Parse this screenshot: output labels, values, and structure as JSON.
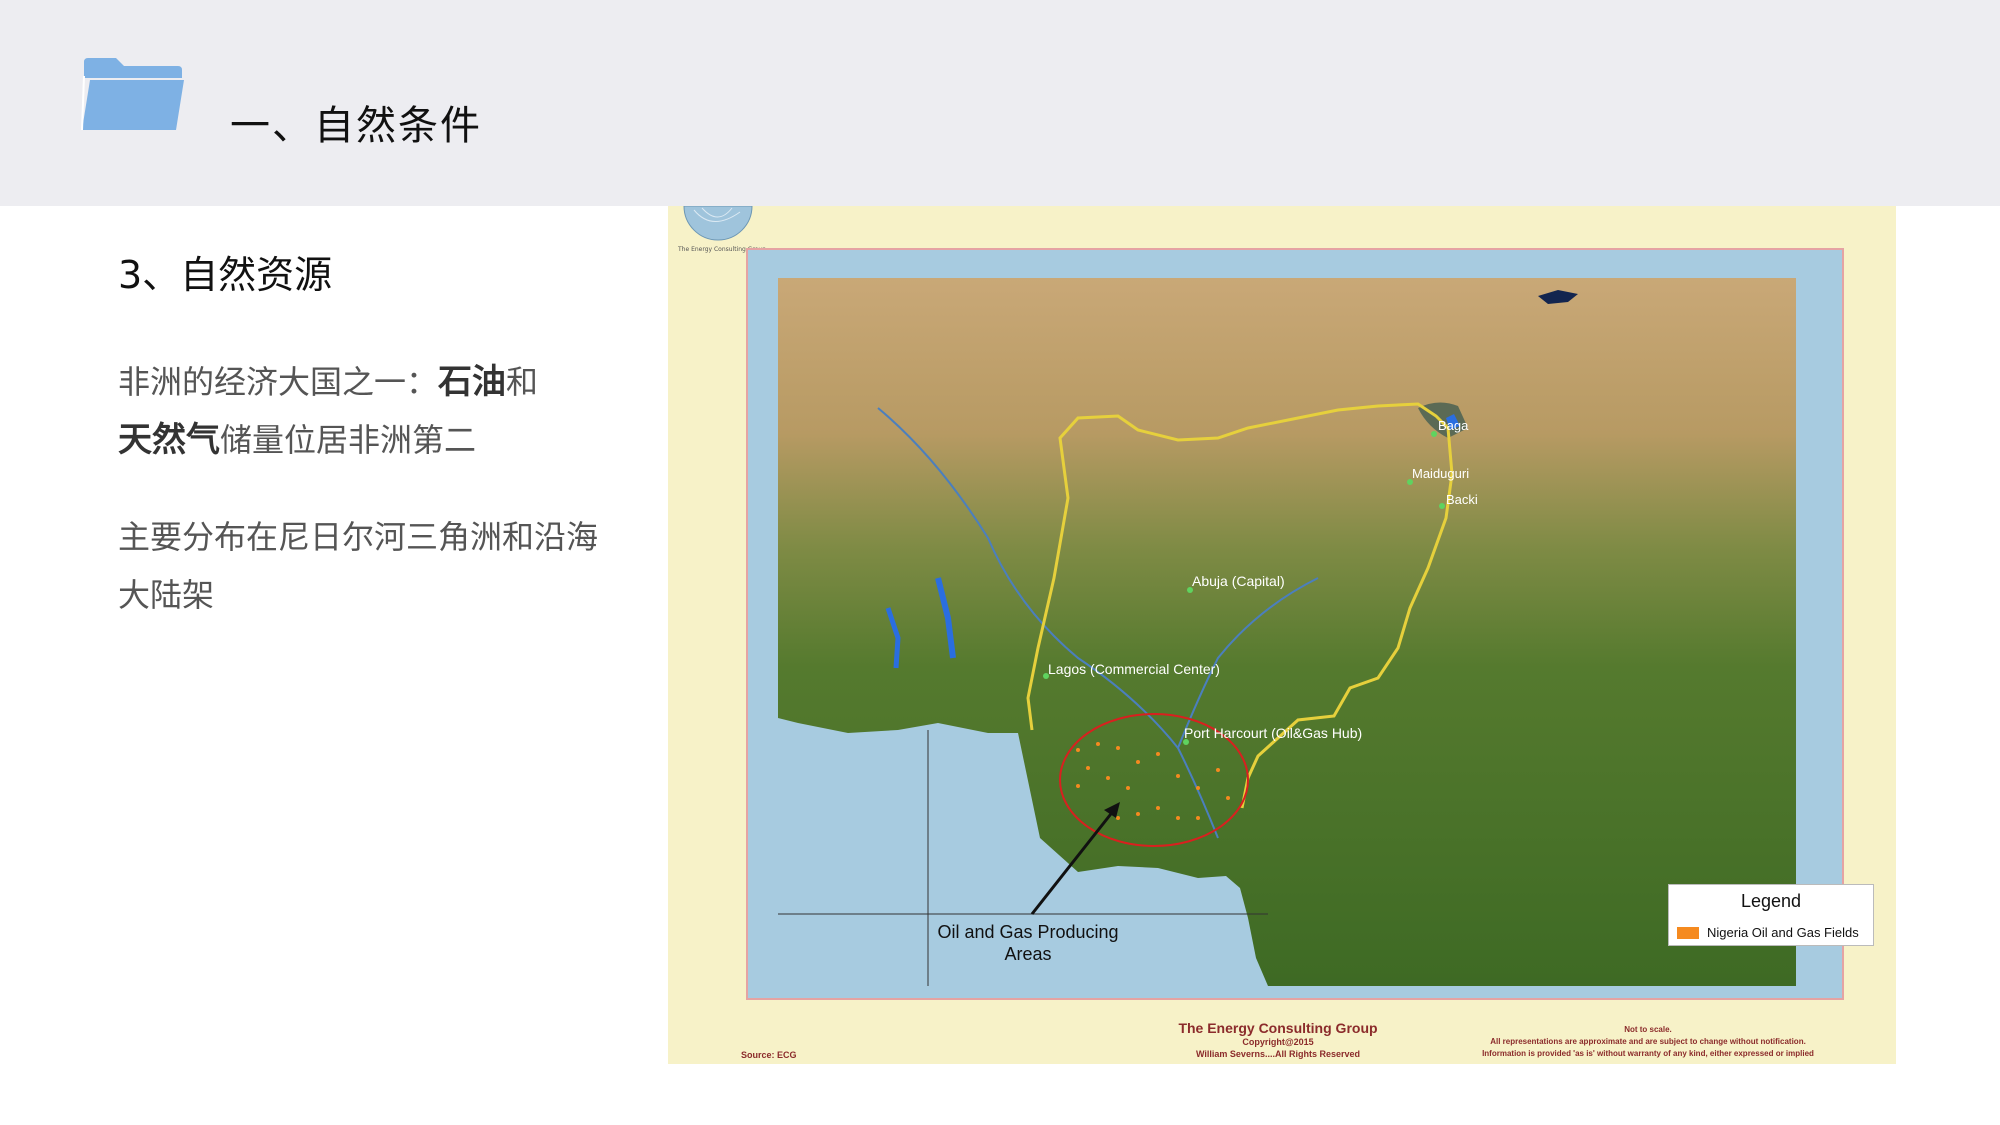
{
  "header": {
    "title": "一、自然条件",
    "icon": "folder-icon",
    "icon_color": "#7eb1e4"
  },
  "content": {
    "subheading": "3、自然资源",
    "paragraph1": {
      "part1": "非洲的经济大国之一：",
      "bold1": "石油",
      "part2": "和",
      "bold2": "天然气",
      "part3": "储量位居非洲第二"
    },
    "paragraph2": "主要分布在尼日尔河三角洲和沿海大陆架"
  },
  "map": {
    "logo_caption": "The Energy Consulting Group",
    "labels": {
      "baga": "Baga",
      "maiduguri": "Maiduguri",
      "backi": "Backi",
      "abuja": "Abuja (Capital)",
      "lagos": "Lagos (Commercial Center)",
      "port_harcourt": "Port Harcourt (Oil&Gas Hub)",
      "oil_areas_line1": "Oil and Gas Producing",
      "oil_areas_line2": "Areas"
    },
    "legend": {
      "title": "Legend",
      "item": "Nigeria Oil and Gas Fields",
      "item_color": "#f58a1f"
    },
    "footer": {
      "company": "The Energy Consulting Group",
      "copyright": "Copyright@2015",
      "rights": "William Severns....All Rights Reserved",
      "source": "Source: ECG",
      "scale": "Not to scale.",
      "disclaimer1": "All representations are approximate and are subject to change without notification.",
      "disclaimer2": "Information is provided 'as is' without warranty of any kind, either expressed or implied"
    }
  }
}
